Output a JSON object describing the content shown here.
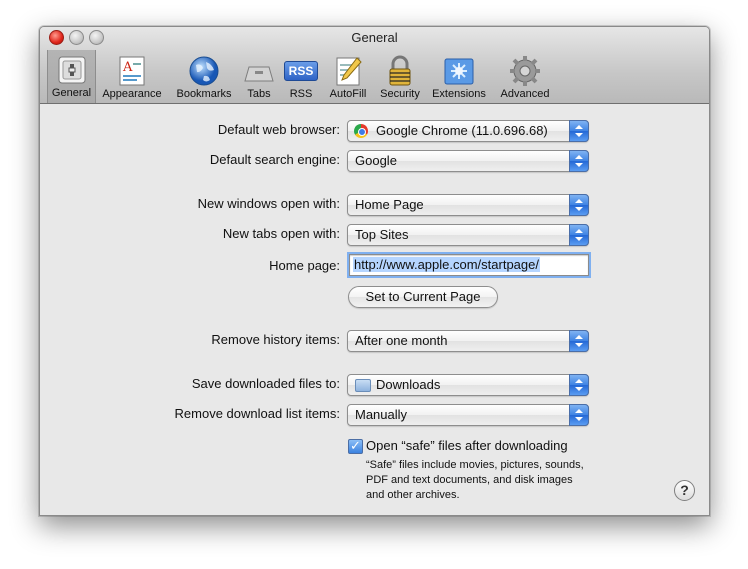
{
  "window": {
    "title": "General"
  },
  "toolbar": {
    "items": [
      {
        "label": "General",
        "icon": "general-switch-icon"
      },
      {
        "label": "Appearance",
        "icon": "appearance-icon"
      },
      {
        "label": "Bookmarks",
        "icon": "globe-icon"
      },
      {
        "label": "Tabs",
        "icon": "tabs-icon"
      },
      {
        "label": "RSS",
        "icon": "rss-icon"
      },
      {
        "label": "AutoFill",
        "icon": "autofill-pencil-icon"
      },
      {
        "label": "Security",
        "icon": "lock-icon"
      },
      {
        "label": "Extensions",
        "icon": "extensions-puzzle-icon"
      },
      {
        "label": "Advanced",
        "icon": "gear-icon"
      }
    ],
    "rss_badge": "RSS"
  },
  "settings": {
    "default_browser": {
      "label": "Default web browser:",
      "value": "Google Chrome (11.0.696.68)"
    },
    "search_engine": {
      "label": "Default search engine:",
      "value": "Google"
    },
    "new_windows": {
      "label": "New windows open with:",
      "value": "Home Page"
    },
    "new_tabs": {
      "label": "New tabs open with:",
      "value": "Top Sites"
    },
    "home_page": {
      "label": "Home page:",
      "value": "http://www.apple.com/startpage/"
    },
    "set_current_button": "Set to Current Page",
    "remove_history": {
      "label": "Remove history items:",
      "value": "After one month"
    },
    "save_downloads": {
      "label": "Save downloaded files to:",
      "value": "Downloads"
    },
    "remove_download_list": {
      "label": "Remove download list items:",
      "value": "Manually"
    },
    "open_safe": {
      "label": "Open “safe” files after downloading",
      "checked": true,
      "note_line1": "“Safe” files include movies, pictures, sounds,",
      "note_line2": "PDF and text documents, and disk images",
      "note_line3": "and other archives."
    }
  },
  "help": "?",
  "colors": {
    "popup_arrow": "#3e83e3",
    "focus_ring": "#7fb0f0",
    "selection": "#b5d5ff"
  }
}
